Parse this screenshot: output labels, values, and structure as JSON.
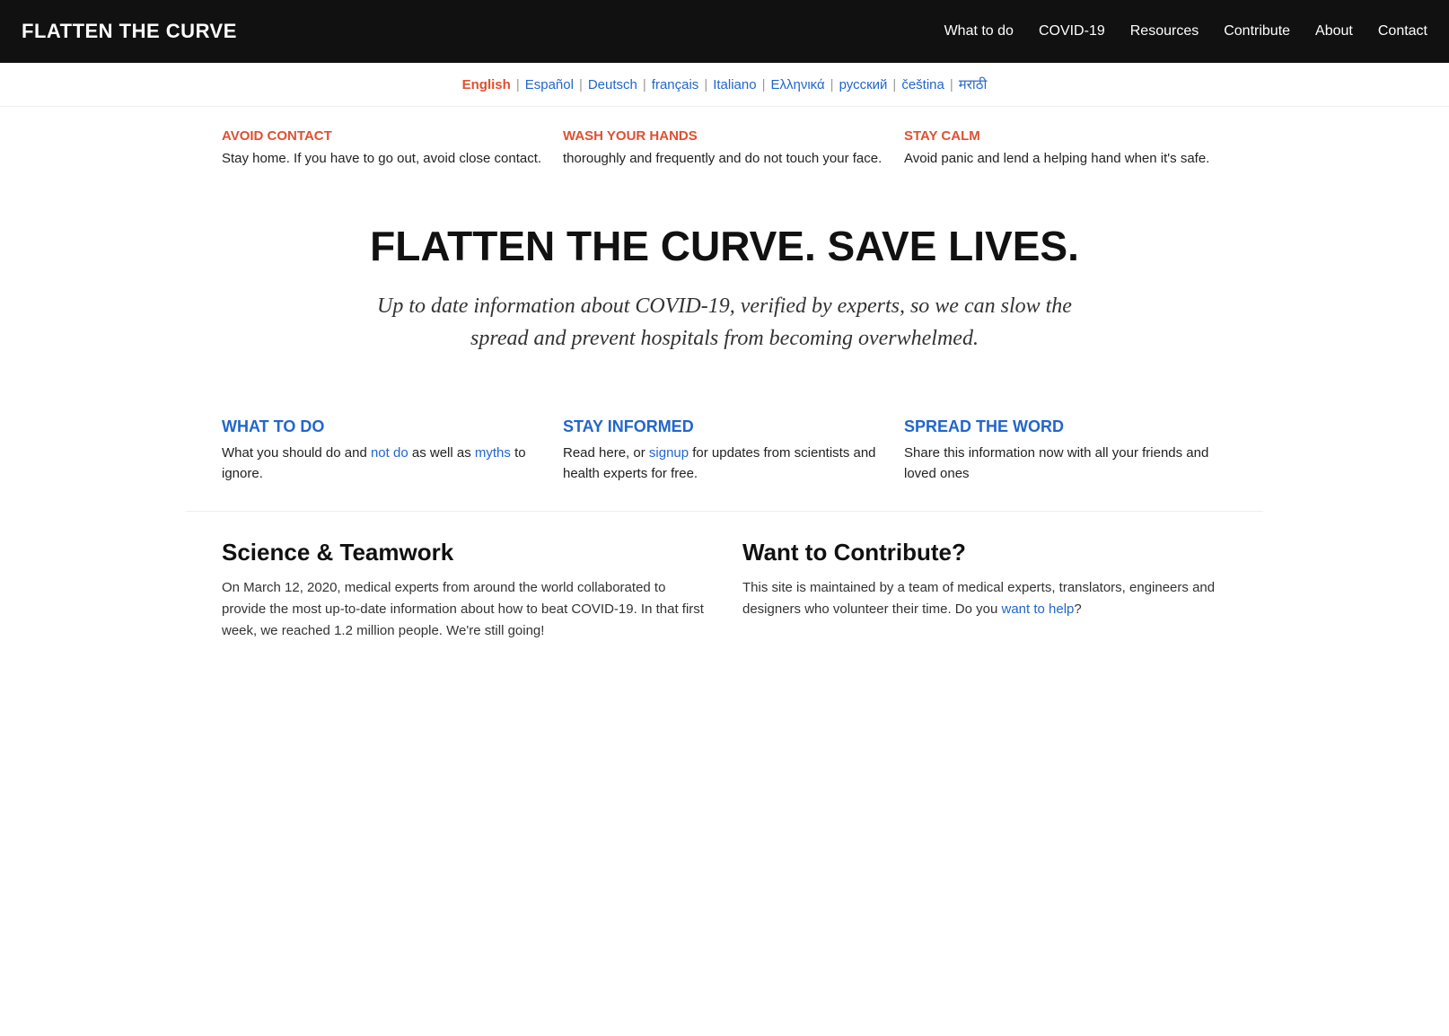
{
  "nav": {
    "logo": "FLATTEN THE CURVE",
    "links": [
      {
        "label": "What to do",
        "href": "#"
      },
      {
        "label": "COVID-19",
        "href": "#"
      },
      {
        "label": "Resources",
        "href": "#"
      },
      {
        "label": "Contribute",
        "href": "#"
      },
      {
        "label": "About",
        "href": "#"
      },
      {
        "label": "Contact",
        "href": "#"
      }
    ]
  },
  "languages": [
    {
      "label": "English",
      "active": true
    },
    {
      "label": "Español",
      "active": false
    },
    {
      "label": "Deutsch",
      "active": false
    },
    {
      "label": "français",
      "active": false
    },
    {
      "label": "Italiano",
      "active": false
    },
    {
      "label": "Ελληνικά",
      "active": false
    },
    {
      "label": "русский",
      "active": false
    },
    {
      "label": "čeština",
      "active": false
    },
    {
      "label": "मराठी",
      "active": false
    }
  ],
  "tips": [
    {
      "title": "AVOID CONTACT",
      "body": "Stay home. If you have to go out, avoid close contact."
    },
    {
      "title": "WASH YOUR HANDS",
      "body": "thoroughly and frequently and do not touch your face."
    },
    {
      "title": "STAY CALM",
      "body": "Avoid panic and lend a helping hand when it's safe."
    }
  ],
  "hero": {
    "title": "FLATTEN THE CURVE. SAVE LIVES.",
    "subtitle": "Up to date information about COVID-19, verified by experts, so we can slow the spread and prevent hospitals from becoming overwhelmed."
  },
  "features": [
    {
      "title": "WHAT TO DO",
      "body_parts": [
        {
          "text": "What you should do",
          "link": false
        },
        {
          "text": " and ",
          "link": false
        },
        {
          "text": "not do",
          "link": true,
          "href": "#"
        },
        {
          "text": " as well as ",
          "link": false
        },
        {
          "text": "myths",
          "link": true,
          "href": "#"
        },
        {
          "text": " to ignore.",
          "link": false
        }
      ]
    },
    {
      "title": "STAY INFORMED",
      "body_parts": [
        {
          "text": "Read here, or ",
          "link": false
        },
        {
          "text": "signup",
          "link": true,
          "href": "#"
        },
        {
          "text": " for updates from scientists and health experts for free.",
          "link": false
        }
      ]
    },
    {
      "title": "SPREAD THE WORD",
      "body_parts": [
        {
          "text": "Share this information now with all your friends and loved ones",
          "link": false
        }
      ]
    }
  ],
  "bottom": {
    "left": {
      "title": "Science & Teamwork",
      "body": "On March 12, 2020, medical experts from around the world collaborated to provide the most up-to-date information about how to beat COVID-19. In that first week, we reached 1.2 million people. We're still going!"
    },
    "right": {
      "title": "Want to Contribute?",
      "body_pre": "This site is maintained by a team of medical experts, translators, engineers and designers who volunteer their time. Do you ",
      "link_text": "want to help",
      "link_href": "#",
      "body_post": "?"
    }
  }
}
